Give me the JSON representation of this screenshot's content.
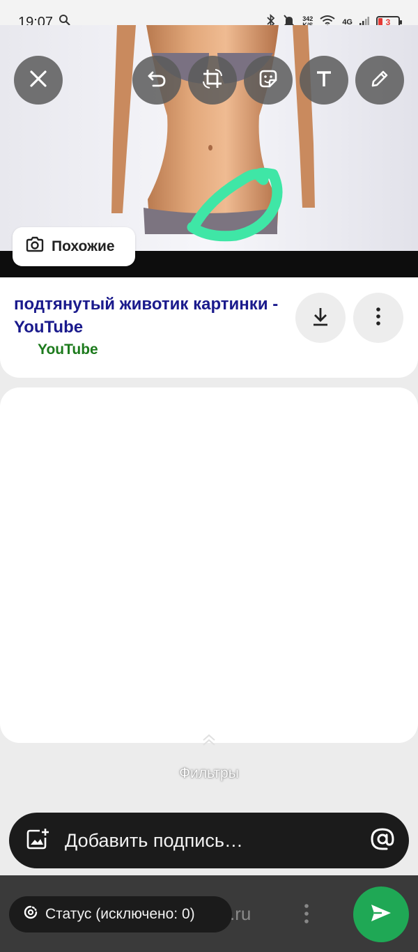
{
  "status_bar": {
    "time": "19:07",
    "net_speed_value": "342",
    "net_speed_unit": "K/S",
    "network_type": "4G",
    "battery_level": "3"
  },
  "result": {
    "similar_label": "Похожие",
    "title": "подтянутый животик картинки - YouTube",
    "source": "YouTube"
  },
  "filters": {
    "label": "Фильтры"
  },
  "caption": {
    "placeholder": "Добавить подпись…"
  },
  "status_chip": {
    "label": "Статус (исключено: 0)"
  },
  "background_text": {
    "domain_fragment": ".ru"
  },
  "colors": {
    "title": "#1a1a8c",
    "source": "#1c7a1c",
    "send_button": "#1fa855",
    "drawing_stroke": "#3fe6a6"
  }
}
